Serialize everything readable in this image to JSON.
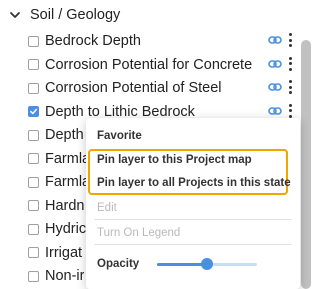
{
  "section": {
    "title": "Soil / Geology"
  },
  "layers": [
    {
      "label": "Bedrock Depth",
      "checked": false,
      "has_actions": true
    },
    {
      "label": "Corrosion Potential for Concrete",
      "checked": false,
      "has_actions": true
    },
    {
      "label": "Corrosion Potential of Steel",
      "checked": false,
      "has_actions": true
    },
    {
      "label": "Depth to Lithic Bedrock",
      "checked": true,
      "has_actions": true
    },
    {
      "label": "Depth",
      "checked": false,
      "has_actions": false
    },
    {
      "label": "Farmla",
      "checked": false,
      "has_actions": false
    },
    {
      "label": "Farmla",
      "checked": false,
      "has_actions": false
    },
    {
      "label": "Hardn",
      "checked": false,
      "has_actions": false
    },
    {
      "label": "Hydric",
      "checked": false,
      "has_actions": false
    },
    {
      "label": "Irrigat",
      "checked": false,
      "has_actions": false
    },
    {
      "label": "Non-ir",
      "checked": false,
      "has_actions": false
    }
  ],
  "context_menu": {
    "favorite": "Favorite",
    "pin_project": "Pin layer to this Project map",
    "pin_all": "Pin layer to all Projects in this state",
    "edit": "Edit",
    "turn_on_legend": "Turn On Legend",
    "opacity_label": "Opacity",
    "opacity_value": 0.5
  },
  "colors": {
    "accent": "#4a90e2",
    "highlight_border": "#f0a500",
    "disabled_text": "#b9b9b9"
  }
}
